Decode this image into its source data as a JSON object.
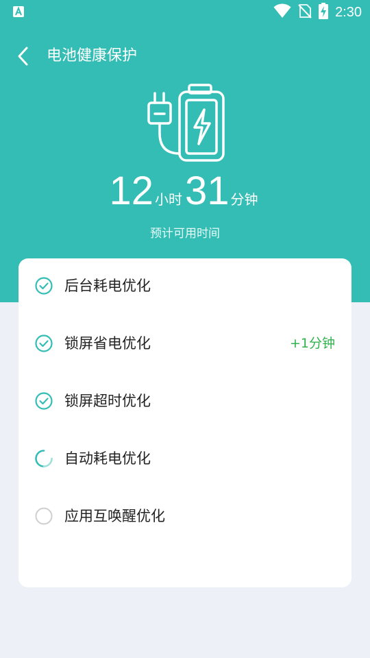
{
  "status_bar": {
    "time": "2:30",
    "icons": [
      "app-store-icon",
      "wifi-icon",
      "no-sim-icon",
      "battery-charging-icon"
    ]
  },
  "header": {
    "title": "电池健康保护",
    "back_icon": "chevron-left-icon"
  },
  "hero": {
    "hours": "12",
    "hours_unit": "小时",
    "minutes": "31",
    "minutes_unit": "分钟",
    "caption": "预计可用时间",
    "illustration": "battery-plug-icon"
  },
  "optimizations": [
    {
      "label": "后台耗电优化",
      "status": "done",
      "badge": ""
    },
    {
      "label": "锁屏省电优化",
      "status": "done",
      "badge": "+1分钟"
    },
    {
      "label": "锁屏超时优化",
      "status": "done",
      "badge": ""
    },
    {
      "label": "自动耗电优化",
      "status": "in-progress",
      "badge": ""
    },
    {
      "label": "应用互唤醒优化",
      "status": "pending",
      "badge": ""
    }
  ],
  "colors": {
    "primary": "#34bdb4",
    "background": "#eef0f7",
    "badge": "#2fb24c",
    "pending_ring": "#cfcfcf"
  }
}
